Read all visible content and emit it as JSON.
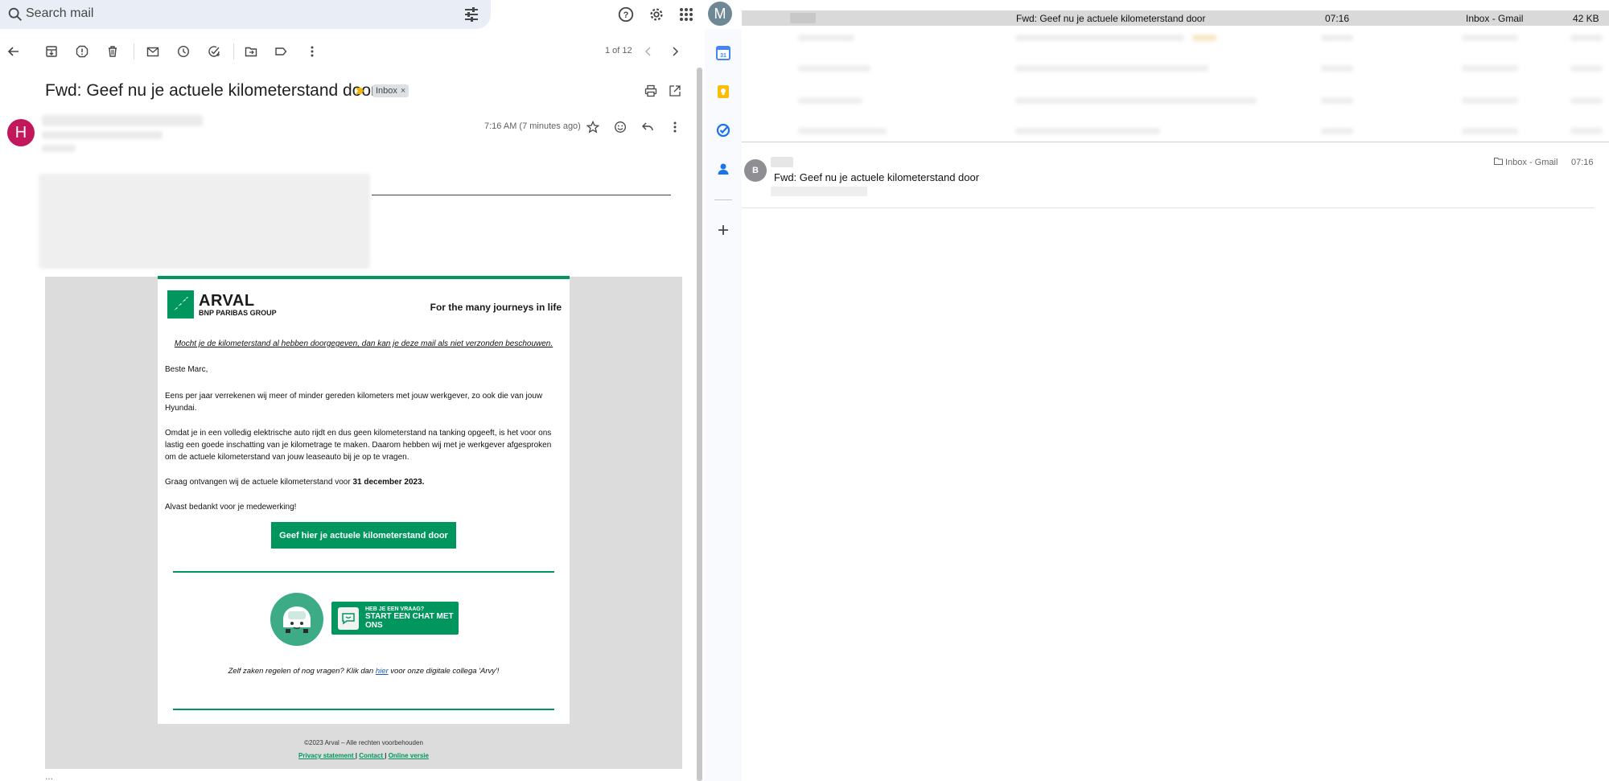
{
  "search": {
    "placeholder": "Search mail"
  },
  "account": {
    "initial": "M"
  },
  "toolbar": {
    "pager": "1 of 12"
  },
  "message": {
    "subject": "Fwd: Geef nu je actuele kilometerstand door",
    "label_chip": "Inbox",
    "sender_initial": "H",
    "time": "7:16 AM (7 minutes ago)"
  },
  "email": {
    "brand_name": "ARVAL",
    "brand_group": "BNP PARIBAS GROUP",
    "tagline": "For the many journeys in life",
    "notice": "Mocht je de kilometerstand al hebben doorgegeven, dan kan je deze mail als niet verzonden beschouwen.",
    "greeting": "Beste Marc,",
    "para1": "Eens per jaar verrekenen wij meer of minder gereden kilometers met jouw werkgever, zo ook die van jouw Hyundai.",
    "para2": "Omdat je in een volledig elektrische auto rijdt en dus geen kilometerstand na tanking opgeeft, is het voor ons lastig een goede inschatting van je kilometrage te maken. Daarom hebben wij met je werkgever afgesproken om de actuele kilometerstand van jouw leaseauto bij je op te vragen.",
    "para3_prefix": "Graag ontvangen wij de actuele kilometerstand voor ",
    "para3_deadline": "31 december 2023.",
    "thanks": "Alvast bedankt voor je medewerking!",
    "cta_label": "Geef hier je actuele kilometerstand door",
    "chat_line1": "HEB JE EEN VRAAG?",
    "chat_line2": "START EEN CHAT MET ONS",
    "help_prefix": "Zelf zaken regelen of nog vragen? Klik dan ",
    "help_link": "hier",
    "help_suffix": " voor onze digitale collega 'Arvy'!",
    "copyright": "©2023 Arval – Alle rechten voorbehouden",
    "footer_link1": "Privacy statement ",
    "footer_sep1": " | ",
    "footer_link2": "Contact ",
    "footer_sep2": "| ",
    "footer_link3": "Online versie",
    "trailing": "..."
  },
  "mailapp": {
    "selected_row": {
      "subject": "Fwd: Geef nu je actuele kilometerstand door",
      "time": "07:16",
      "mailbox": "Inbox - Gmail",
      "size": "42 KB"
    },
    "preview": {
      "avatar": "B",
      "subject": "Fwd: Geef nu je actuele kilometerstand door",
      "mailbox": "Inbox - Gmail",
      "time": "07:16"
    }
  },
  "colors": {
    "arval_green": "#00965e",
    "gmail_search_bg": "#e9eef6",
    "sender_avatar": "#c2185b"
  },
  "icons": [
    "search-icon",
    "tune-icon",
    "help-icon",
    "settings-icon",
    "apps-icon",
    "back-icon",
    "archive-icon",
    "report-spam-icon",
    "delete-icon",
    "mark-unread-icon",
    "snooze-icon",
    "add-task-icon",
    "move-to-icon",
    "label-icon",
    "more-icon",
    "chevron-left-icon",
    "chevron-right-icon",
    "print-icon",
    "open-new-window-icon",
    "star-icon",
    "emoji-icon",
    "reply-icon",
    "calendar-icon",
    "keep-icon",
    "tasks-icon",
    "contacts-icon",
    "plus-icon",
    "folder-icon"
  ]
}
